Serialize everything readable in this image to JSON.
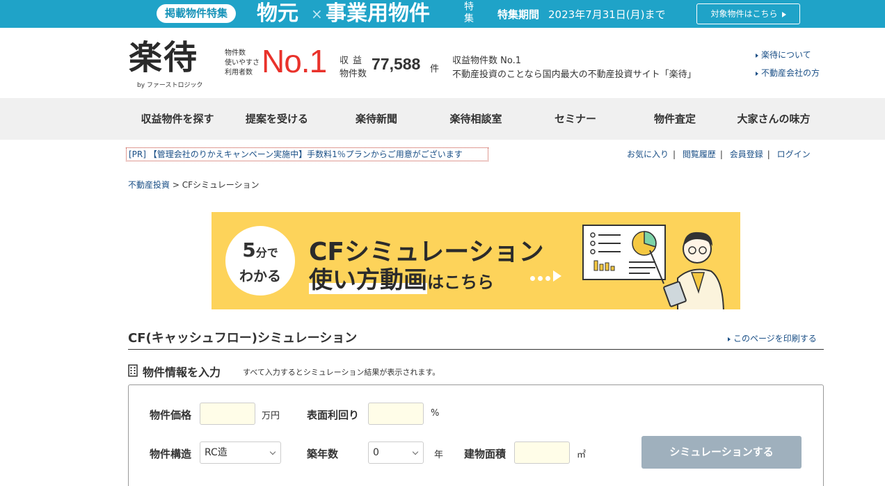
{
  "top_banner": {
    "pill": "掲載物件特集",
    "word1": "物元",
    "x": "×",
    "word2": "事業用物件",
    "toku": "特集",
    "period_label": "特集期間",
    "period_date": "2023年7月31日(月)まで",
    "cta": "対象物件はこちら"
  },
  "header": {
    "logo": "楽待",
    "logo_sub": "by ファーストロジック",
    "no1_lines": [
      "物件数",
      "使いやすさ",
      "利用者数"
    ],
    "no1": "No.1",
    "count_label1": "収益",
    "count_label2": "物件数",
    "count": "77,588",
    "count_unit": "件",
    "tagline1": "収益物件数 No.1",
    "tagline2": "不動産投資のことなら国内最大の不動産投資サイト「楽待」",
    "link_about": "楽待について",
    "link_company": "不動産会社の方"
  },
  "nav": [
    "収益物件を探す",
    "提案を受ける",
    "楽待新聞",
    "楽待相談室",
    "セミナー",
    "物件査定",
    "大家さんの味方"
  ],
  "pr_text": "[PR] 【管理会社のりかえキャンペーン実施中】手数料1％プランからご用意がございます",
  "member_links": [
    "お気に入り",
    "閲覧履歴",
    "会員登録",
    "ログイン"
  ],
  "breadcrumb": {
    "home": "不動産投資",
    "sep": " > ",
    "current": "CFシミュレーション"
  },
  "video_banner": {
    "circle_num": "5",
    "circle_unit": "分で",
    "circle_l2": "わかる",
    "title1": "CFシミュレーション",
    "title2_hl": "使い方動画",
    "title2_rest": "はこちら"
  },
  "section": {
    "title": "CF(キャッシュフロー)シミュレーション",
    "print": "このページを印刷する",
    "sub_title": "物件情報を入力",
    "sub_note": "すべて入力するとシミュレーション結果が表示されます。"
  },
  "form": {
    "price_label": "物件価格",
    "price_value": "",
    "price_unit": "万円",
    "yield_label": "表面利回り",
    "yield_value": "",
    "yield_unit": "%",
    "structure_label": "物件構造",
    "structure_value": "RC造",
    "age_label": "築年数",
    "age_value": "0",
    "age_unit": "年",
    "area_label": "建物面積",
    "area_value": "",
    "area_unit": "㎡",
    "submit": "シミュレーションする"
  },
  "colors": {
    "banner_blue": "#1fa3c8",
    "no1_red": "#e9322b",
    "link_blue": "#1a4f86",
    "video_yellow": "#fdd35a",
    "button_gray": "#9fb0bd",
    "input_bg": "#fffde8"
  }
}
